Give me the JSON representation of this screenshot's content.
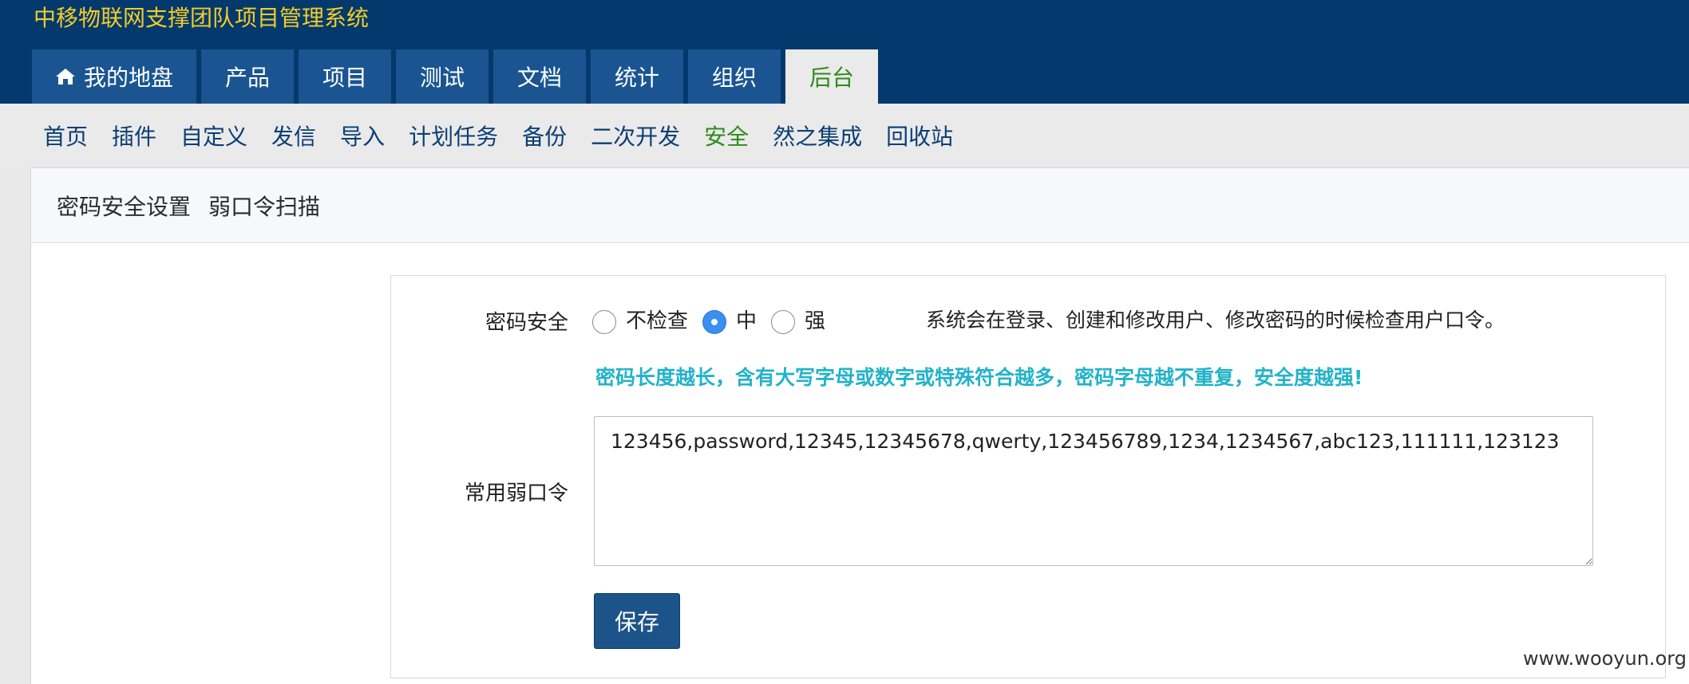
{
  "app_title": "中移物联网支撑团队项目管理系统",
  "main_nav": [
    {
      "label": "我的地盘",
      "icon": "home-icon"
    },
    {
      "label": "产品"
    },
    {
      "label": "项目"
    },
    {
      "label": "测试"
    },
    {
      "label": "文档"
    },
    {
      "label": "统计"
    },
    {
      "label": "组织"
    },
    {
      "label": "后台",
      "active": true
    }
  ],
  "sub_nav": [
    {
      "label": "首页"
    },
    {
      "label": "插件"
    },
    {
      "label": "自定义"
    },
    {
      "label": "发信"
    },
    {
      "label": "导入"
    },
    {
      "label": "计划任务"
    },
    {
      "label": "备份"
    },
    {
      "label": "二次开发"
    },
    {
      "label": "安全",
      "active": true
    },
    {
      "label": "然之集成"
    },
    {
      "label": "回收站"
    }
  ],
  "panel_tabs": [
    "密码安全设置",
    "弱口令扫描"
  ],
  "form": {
    "security_label": "密码安全",
    "options": [
      "不检查",
      "中",
      "强"
    ],
    "selected": "中",
    "help_text": "系统会在登录、创建和修改用户、修改密码的时候检查用户口令。",
    "tip_text": "密码长度越长，含有大写字母或数字或特殊符合越多，密码字母越不重复，安全度越强!",
    "weak_label": "常用弱口令",
    "weak_value": "123456,password,12345,12345678,qwerty,123456789,1234,1234567,abc123,111111,123123",
    "save_label": "保存"
  },
  "watermark": "www.wooyun.org",
  "colors": {
    "header_bg": "#03396c",
    "tab_bg": "#1a5592",
    "title_yellow": "#f2cc28",
    "active_green": "#2e8b1a",
    "tip_cyan": "#22b3c9",
    "save_button": "#1c5389"
  }
}
